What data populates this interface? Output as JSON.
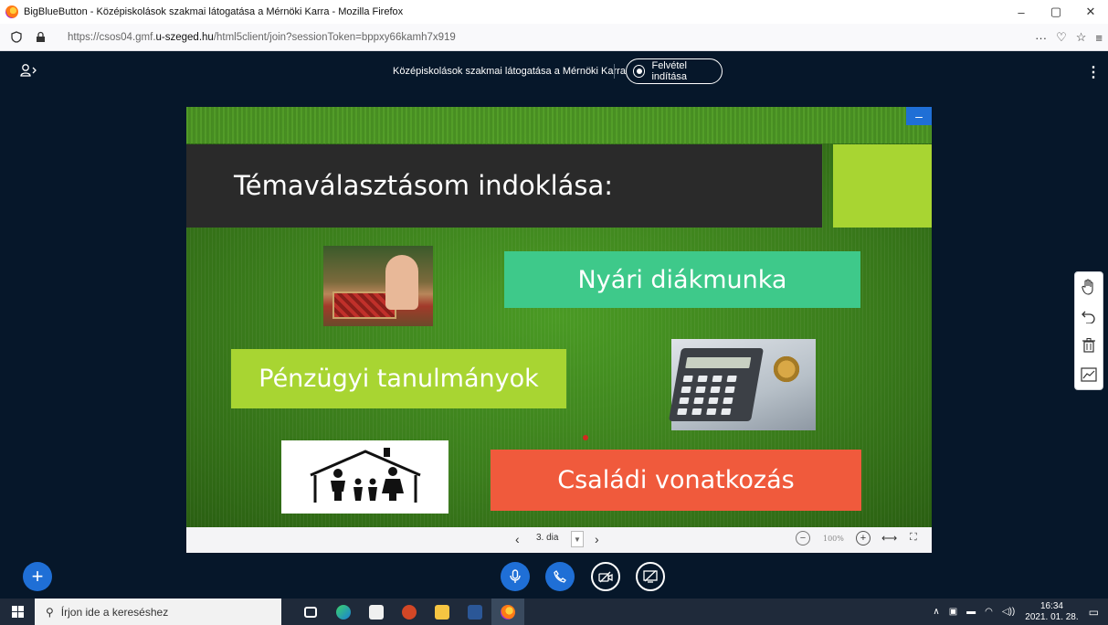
{
  "browser": {
    "window_title": "BigBlueButton - Középiskolások szakmai látogatása a Mérnöki Karra - Mozilla Firefox",
    "url_prefix": "https://csos04.gmf.",
    "url_domain": "u-szeged.hu",
    "url_suffix": "/html5client/join?sessionToken=bppxy66kamh7x919",
    "window_buttons": [
      "–",
      "▢",
      "✕"
    ],
    "nav_right": [
      "···",
      "♡",
      "☆",
      "≡"
    ]
  },
  "bbb": {
    "meeting_title": "Középiskolások szakmai látogatása a Mérnöki Karra",
    "record_label": "Felvétel indítása"
  },
  "slide": {
    "title": "Témaválasztásom indoklása:",
    "box_summer": "Nyári diákmunka",
    "box_finance": "Pénzügyi tanulmányok",
    "box_family": "Családi vonatkozás",
    "minimize_label": "–"
  },
  "slide_controls": {
    "current_slide": "3. dia",
    "zoom": "100%",
    "prev": "‹",
    "next": "›"
  },
  "taskbar": {
    "search_placeholder": "Írjon ide a kereséshez",
    "time": "16:34",
    "date": "2021. 01. 28."
  },
  "colors": {
    "bbb_background": "#06172a",
    "accent_blue": "#1f6fd6",
    "slide_green": "#3b7d1c",
    "box_summer": "#3ec98a",
    "box_finance": "#a8d532",
    "box_family": "#f05a3c"
  },
  "icons": {
    "wb_tools": [
      "hand-icon",
      "undo-icon",
      "trash-icon",
      "multi-user-icon"
    ],
    "media": [
      "mic-icon",
      "phone-icon",
      "camera-off-icon",
      "screenshare-off-icon"
    ]
  }
}
